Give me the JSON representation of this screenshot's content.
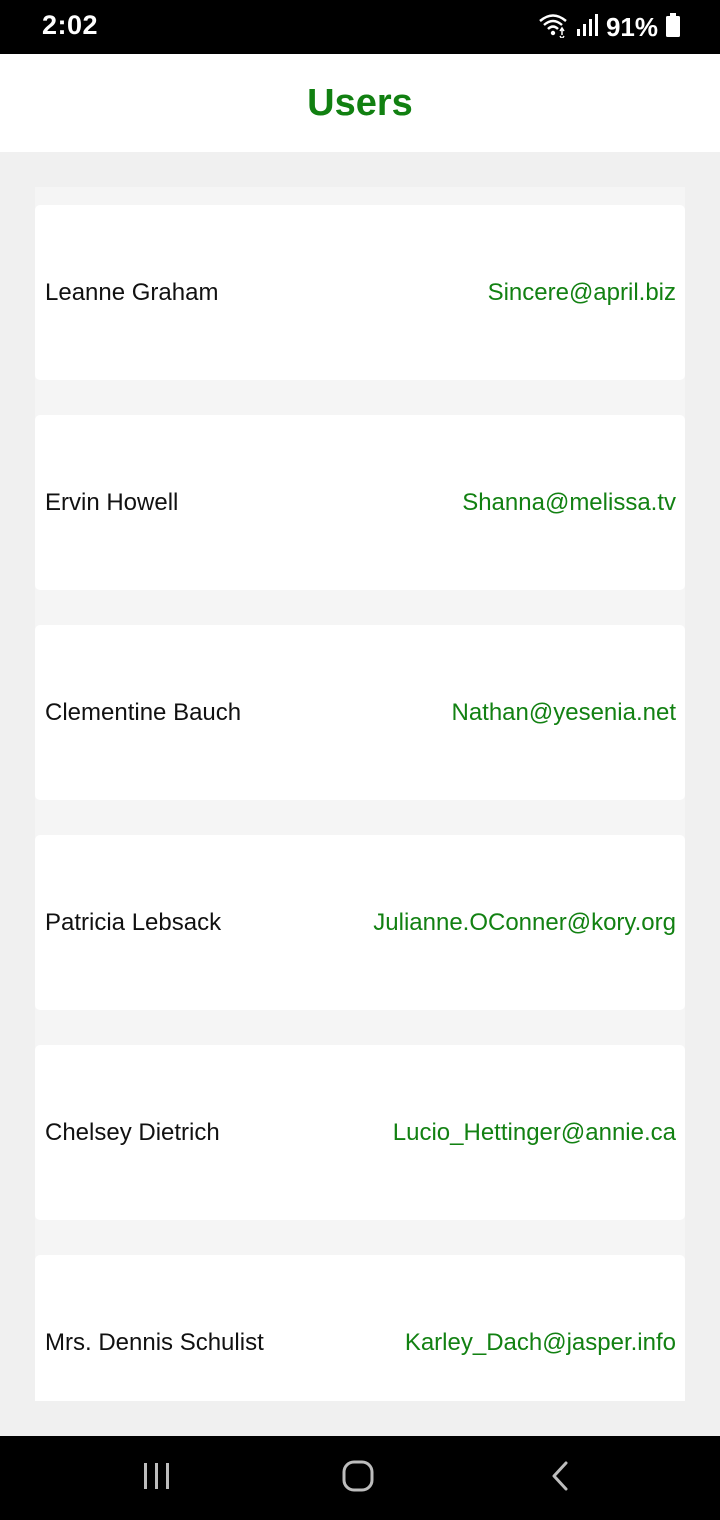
{
  "status_bar": {
    "time": "2:02",
    "battery_percent": "91%",
    "icons": [
      "wifi-icon",
      "signal-icon",
      "battery-icon"
    ]
  },
  "header": {
    "title": "Users"
  },
  "users": [
    {
      "name": "Leanne Graham",
      "email": "Sincere@april.biz"
    },
    {
      "name": "Ervin Howell",
      "email": "Shanna@melissa.tv"
    },
    {
      "name": "Clementine Bauch",
      "email": "Nathan@yesenia.net"
    },
    {
      "name": "Patricia Lebsack",
      "email": "Julianne.OConner@kory.org"
    },
    {
      "name": "Chelsey Dietrich",
      "email": "Lucio_Hettinger@annie.ca"
    },
    {
      "name": "Mrs. Dennis Schulist",
      "email": "Karley_Dach@jasper.info"
    }
  ],
  "nav_bar": {
    "buttons": [
      "recent-apps-icon",
      "home-icon",
      "back-icon"
    ]
  },
  "colors": {
    "accent": "#118011",
    "card_bg": "#ffffff",
    "page_bg": "#f0f0f0"
  }
}
